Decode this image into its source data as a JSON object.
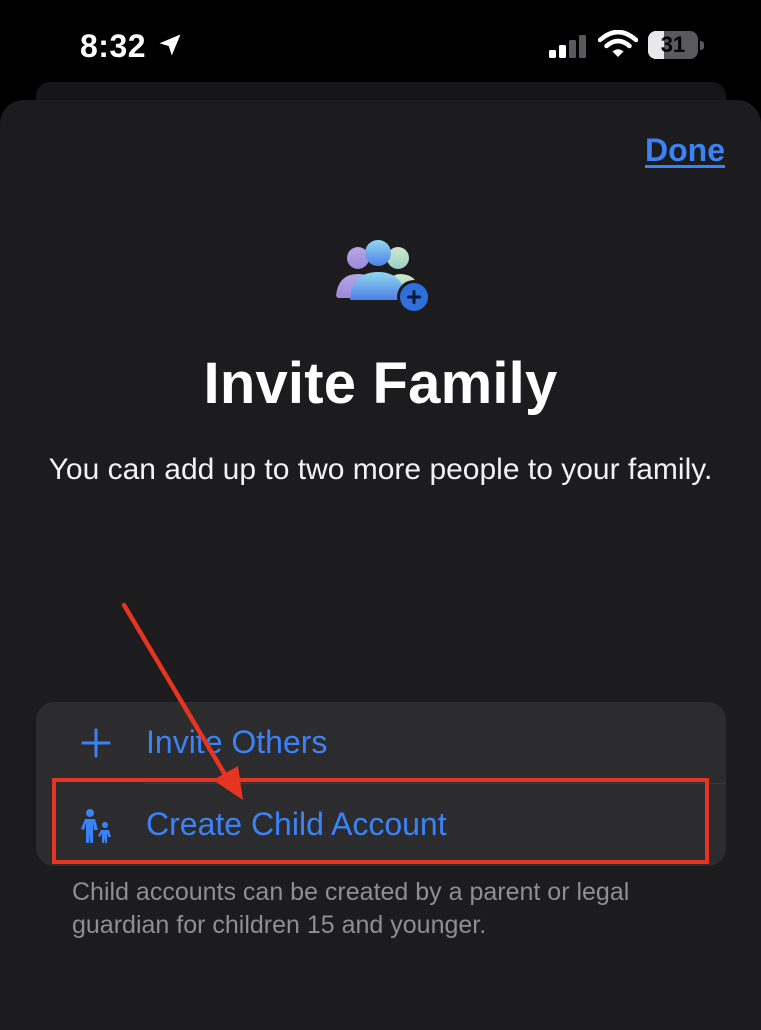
{
  "status_bar": {
    "time": "8:32",
    "battery_level": "31",
    "battery_fraction": 0.31,
    "icons": [
      "location-arrow-icon",
      "cellular-signal-icon",
      "wifi-icon",
      "battery-icon"
    ]
  },
  "sheet": {
    "done_label": "Done",
    "title": "Invite Family",
    "subtitle": "You can add up to two more people to your family.",
    "options": [
      {
        "label": "Invite Others",
        "icon": "plus-icon"
      },
      {
        "label": "Create Child Account",
        "icon": "parent-child-icon"
      }
    ],
    "footnote": "Child accounts can be created by a parent or legal guardian for children 15 and younger."
  },
  "annotation": {
    "color": "#e5341f",
    "target": "Create Child Account"
  },
  "colors": {
    "accent": "#3b82f6",
    "background": "#000000",
    "sheet": "#1c1c1e",
    "group": "#2c2c2e"
  }
}
